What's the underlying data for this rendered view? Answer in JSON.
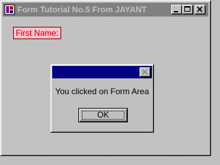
{
  "window": {
    "title": "Form Tutorial No.5 From JAYANT",
    "icon": "app-icon",
    "controls": [
      "minimize-icon",
      "maximize-icon",
      "close-icon"
    ]
  },
  "form": {
    "first_name_label": "First Name:"
  },
  "dialog": {
    "message": "You clicked on Form Area",
    "ok_label": "OK",
    "close_icon": "close-icon"
  },
  "colors": {
    "inactive_title": "#808080",
    "dialog_title": "#000080",
    "label_bg": "#ffc0cb",
    "label_text": "#c00000",
    "face": "#c0c0c0"
  }
}
